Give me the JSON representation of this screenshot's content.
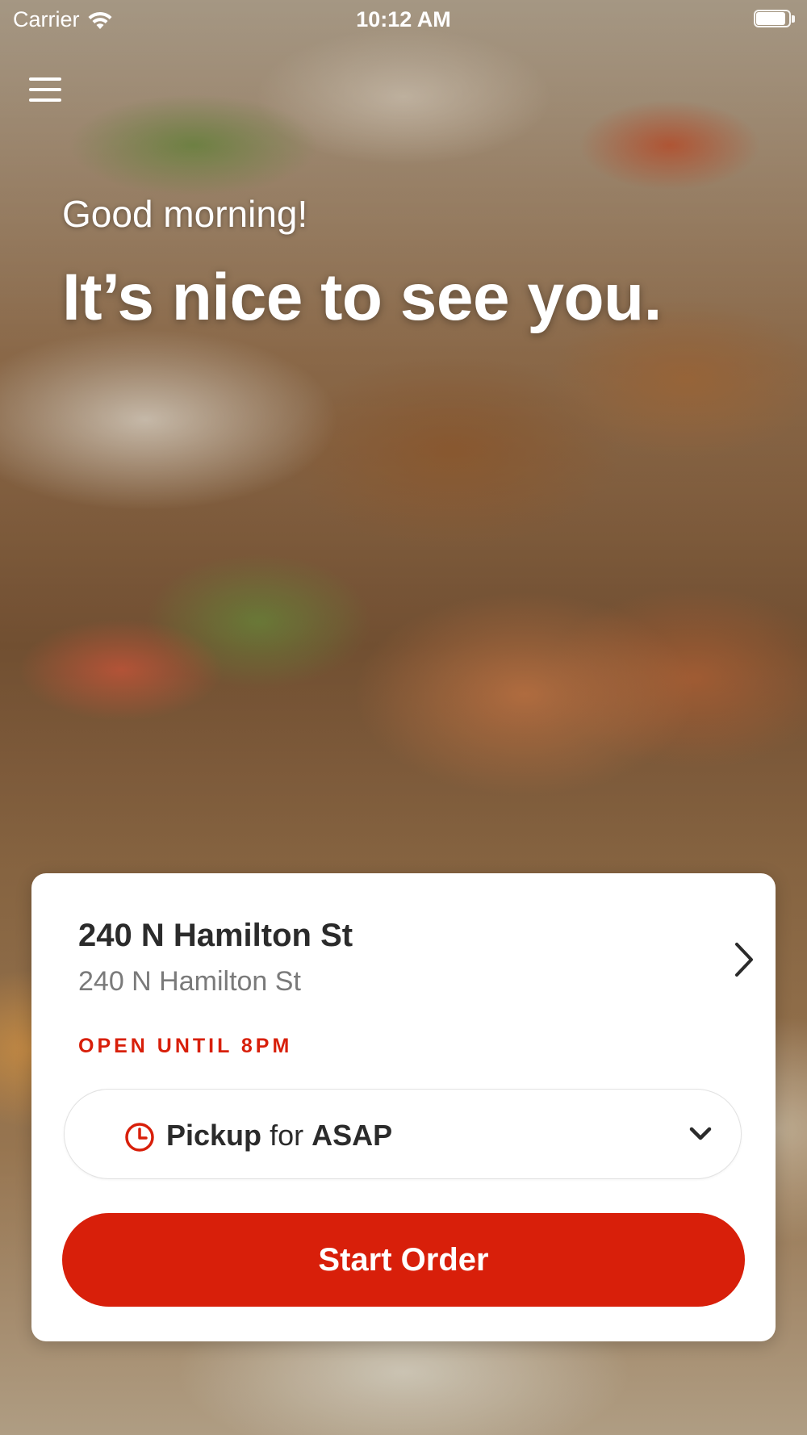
{
  "status_bar": {
    "carrier": "Carrier",
    "time": "10:12 AM"
  },
  "hero": {
    "greeting": "Good morning!",
    "headline": "It’s nice to see you."
  },
  "store": {
    "name": "240 N Hamilton St",
    "address": "240 N Hamilton St",
    "hours": "OPEN UNTIL 8PM"
  },
  "order_type": {
    "mode": "Pickup",
    "connector": "for",
    "time": "ASAP"
  },
  "actions": {
    "start_order": "Start Order"
  },
  "icons": {
    "menu": "hamburger-menu-icon",
    "wifi": "wifi-icon",
    "battery": "battery-icon",
    "store_chevron": "chevron-right-icon",
    "clock": "clock-icon",
    "dropdown": "chevron-down-icon"
  },
  "colors": {
    "accent": "#d81f0a",
    "text_primary": "#2b2b2b",
    "text_secondary": "#7a7a7a",
    "card_background": "#ffffff"
  }
}
